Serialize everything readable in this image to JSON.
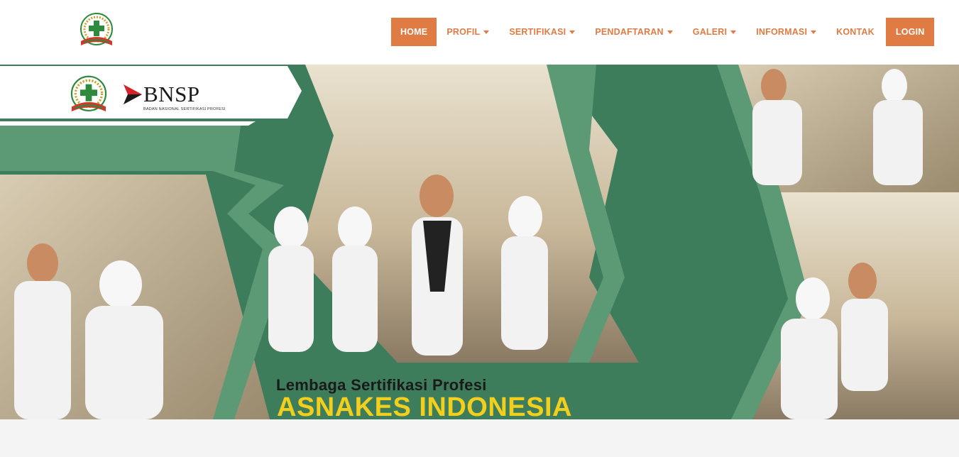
{
  "navbar": {
    "logo_icon": "lsp-asnakes-seal-icon",
    "items": [
      {
        "label": "HOME",
        "active": true,
        "dropdown": false
      },
      {
        "label": "PROFIL",
        "active": false,
        "dropdown": true
      },
      {
        "label": "SERTIFIKASI",
        "active": false,
        "dropdown": true
      },
      {
        "label": "PENDAFTARAN",
        "active": false,
        "dropdown": true
      },
      {
        "label": "GALERI",
        "active": false,
        "dropdown": true
      },
      {
        "label": "INFORMASI",
        "active": false,
        "dropdown": true
      },
      {
        "label": "KONTAK",
        "active": false,
        "dropdown": false
      }
    ],
    "login_label": "LOGIN"
  },
  "hero": {
    "bnsp_word": "BNSP",
    "bnsp_subtitle": "BADAN NASIONAL SERTIFIKASI PROFESI",
    "caption_line1": "Lembaga Sertifikasi Profesi",
    "caption_line2": "ASNAKES INDONESIA"
  },
  "colors": {
    "accent": "#e07b44",
    "green": "#3e7d5b",
    "caption_yellow": "#f2cf1c"
  }
}
